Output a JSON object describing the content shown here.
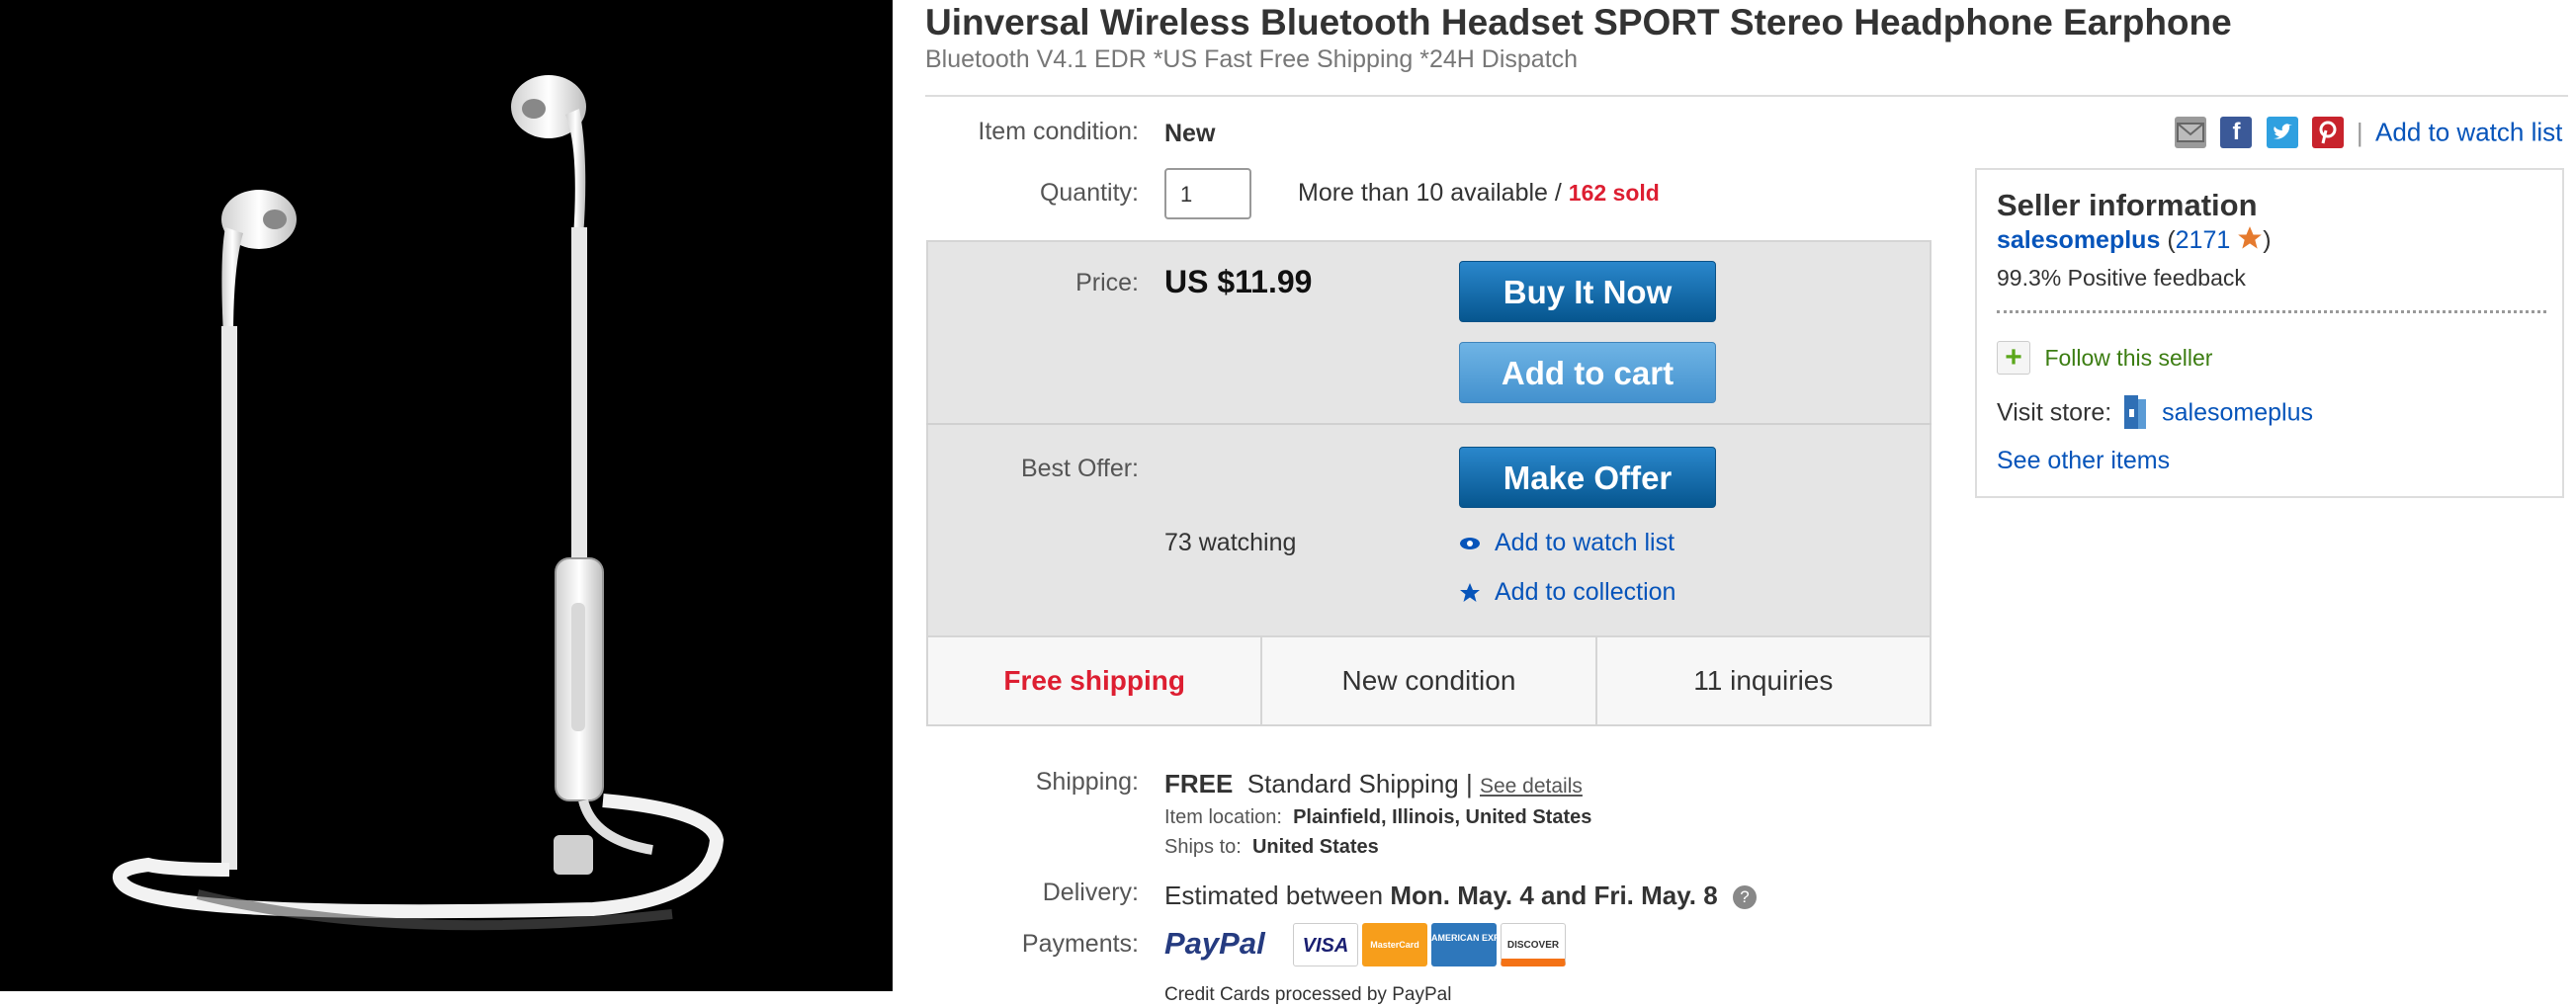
{
  "product": {
    "title": "Uinversal Wireless Bluetooth Headset SPORT Stereo Headphone Earphone",
    "subtitle": "Bluetooth V4.1 EDR *US Fast Free Shipping *24H Dispatch"
  },
  "condition": {
    "label": "Item condition:",
    "value": "New"
  },
  "quantity": {
    "label": "Quantity:",
    "value": "1",
    "available": "More than 10 available / ",
    "sold": "162 sold"
  },
  "social": {
    "add_watch": "Add to watch list",
    "separator": "|"
  },
  "price": {
    "label": "Price:",
    "value": "US $11.99"
  },
  "buttons": {
    "buy_now": "Buy It Now",
    "add_cart": "Add to cart",
    "make_offer": "Make Offer"
  },
  "offer": {
    "label": "Best Offer:",
    "watching": "73 watching",
    "add_watch": "Add to watch list",
    "add_collection": "Add to collection"
  },
  "infobar": {
    "shipping": "Free shipping",
    "condition": "New condition",
    "inquiries": "11 inquiries"
  },
  "shipping": {
    "label": "Shipping:",
    "free": "FREE",
    "method": "Standard Shipping",
    "pipe": "|",
    "details": "See details",
    "location_label": "Item location:",
    "location": "Plainfield, Illinois, United States",
    "ships_label": "Ships to:",
    "ships_to": "United States"
  },
  "delivery": {
    "label": "Delivery:",
    "prefix": "Estimated between ",
    "dates": "Mon. May. 4 and Fri. May. 8"
  },
  "payments": {
    "label": "Payments:",
    "paypal": "PayPal",
    "cards": [
      "VISA",
      "MasterCard",
      "AMERICAN EXPRESS",
      "DISCOVER"
    ],
    "note": "Credit Cards processed by PayPal"
  },
  "seller": {
    "heading": "Seller information",
    "name": "salesomeplus",
    "score_open": "(",
    "score": "2171",
    "score_close": ")",
    "feedback": "99.3% Positive feedback",
    "follow": "Follow this seller",
    "visit_label": "Visit store:",
    "store": "salesomeplus",
    "other_items": "See other items"
  },
  "colors": {
    "accent_blue": "#0654ba",
    "sold_red": "#dd1e31",
    "follow_green": "#5ba71b",
    "star_orange": "#e57a2e"
  }
}
